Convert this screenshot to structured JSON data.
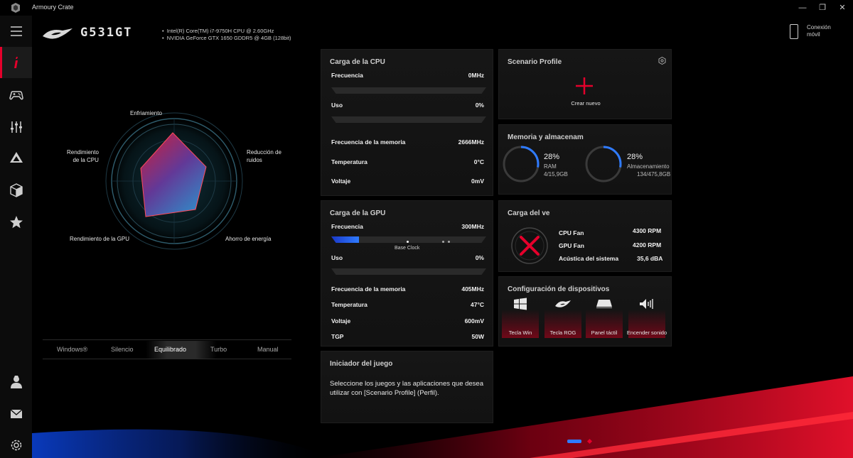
{
  "window": {
    "title": "Armoury Crate",
    "controls": [
      "—",
      "❐",
      "✕"
    ]
  },
  "sidebar": {
    "items": [
      {
        "name": "info",
        "icon": "info-icon"
      },
      {
        "name": "gamepad",
        "icon": "gamepad-icon"
      },
      {
        "name": "sliders",
        "icon": "sliders-icon"
      },
      {
        "name": "aura",
        "icon": "aura-triangle-icon"
      },
      {
        "name": "box",
        "icon": "cube-icon"
      },
      {
        "name": "favorite",
        "icon": "star-icon"
      },
      {
        "name": "user",
        "icon": "user-icon"
      },
      {
        "name": "mail",
        "icon": "mail-icon"
      },
      {
        "name": "settings",
        "icon": "gear-icon"
      }
    ]
  },
  "header": {
    "model": "G531GT",
    "cpu_spec": "Intel(R) Core(TM) i7-9750H CPU @ 2.60GHz",
    "gpu_spec": "NVIDIA GeForce GTX 1650 GDDR5 @ 4GB (128bit)",
    "mobile_link": "Conexión móvil"
  },
  "radar": {
    "labels": {
      "cooling": "Enfriamiento",
      "noise_line1": "Reducción de",
      "noise_line2": "ruidos",
      "cpu_line1": "Rendimiento",
      "cpu_line2": "de la CPU",
      "gpu": "Rendimiento de la GPU",
      "energy": "Ahorro de energía"
    }
  },
  "modes": {
    "tabs": [
      "Windows®",
      "Silencio",
      "Equilibrado",
      "Turbo",
      "Manual"
    ],
    "active": "Equilibrado"
  },
  "cpu_card": {
    "title": "Carga de la CPU",
    "freq_label": "Frecuencia",
    "freq_value": "0MHz",
    "usage_label": "Uso",
    "usage_value": "0%",
    "mem_freq_label": "Frecuencia de la memoria",
    "mem_freq_value": "2666MHz",
    "temp_label": "Temperatura",
    "temp_value": "0°C",
    "volt_label": "Voltaje",
    "volt_value": "0mV"
  },
  "gpu_card": {
    "title": "Carga de la GPU",
    "freq_label": "Frecuencia",
    "freq_value": "300MHz",
    "base_clock": "Base Clock",
    "freq_fill_pct": 18,
    "usage_label": "Uso",
    "usage_value": "0%",
    "mem_freq_label": "Frecuencia de la memoria",
    "mem_freq_value": "405MHz",
    "temp_label": "Temperatura",
    "temp_value": "47°C",
    "volt_label": "Voltaje",
    "volt_value": "600mV",
    "tgp_label": "TGP",
    "tgp_value": "50W"
  },
  "launcher_card": {
    "title": "Iniciador del juego",
    "desc_line1": "Seleccione los juegos y las aplicaciones que desea",
    "desc_line2": "utilizar con [Scenario Profile] (Perfil)."
  },
  "scenario_card": {
    "title": "Scenario Profile",
    "create_label": "Crear nuevo"
  },
  "memory_card": {
    "title": "Memoria y almacenam",
    "ram_pct": "28%",
    "ram_label": "RAM",
    "ram_detail": "4/15,9GB",
    "ram_level": 0.28,
    "storage_pct": "28%",
    "storage_label": "Almacenamiento",
    "storage_detail": "134/475,8GB",
    "storage_level": 0.28
  },
  "fan_card": {
    "title": "Carga del ve",
    "cpu_fan_label": "CPU Fan",
    "cpu_fan_value": "4300 RPM",
    "gpu_fan_label": "GPU Fan",
    "gpu_fan_value": "4200 RPM",
    "acoustic_label": "Acústica del sistema",
    "acoustic_value": "35,6 dBA"
  },
  "devices_card": {
    "title": "Configuración de dispositivos",
    "items": [
      "Tecla Win",
      "Tecla ROG",
      "Panel táctil",
      "Encender sonido"
    ]
  },
  "colors": {
    "accent": "#e4002b",
    "blue": "#2f7bff",
    "card_bg": "#141414"
  }
}
